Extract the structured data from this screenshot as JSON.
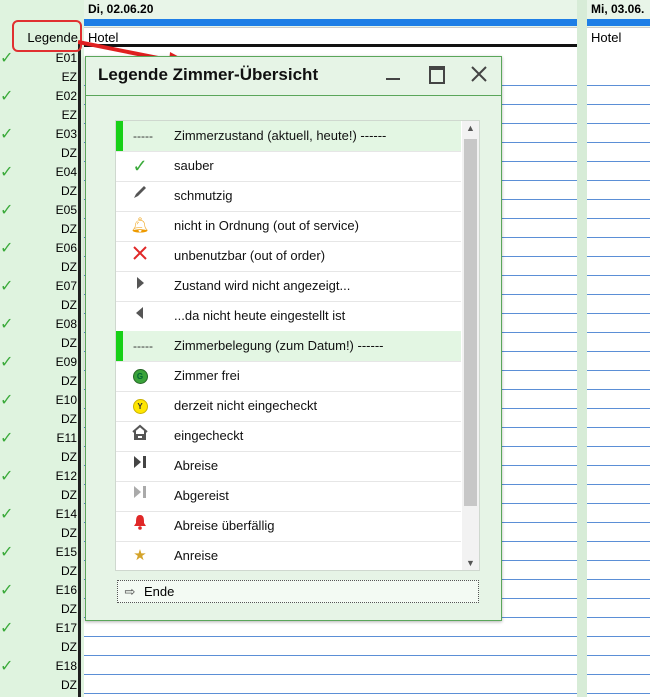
{
  "planner": {
    "legend_label": "Legende",
    "day1_header": "Di, 02.06.20",
    "day2_header": "Mi, 03.06.",
    "hotel_label": "Hotel",
    "rooms": [
      {
        "label": "E01",
        "check": true
      },
      {
        "label": "EZ",
        "check": false
      },
      {
        "label": "E02",
        "check": true
      },
      {
        "label": "EZ",
        "check": false
      },
      {
        "label": "E03",
        "check": true
      },
      {
        "label": "DZ",
        "check": false
      },
      {
        "label": "E04",
        "check": true
      },
      {
        "label": "DZ",
        "check": false
      },
      {
        "label": "E05",
        "check": true
      },
      {
        "label": "DZ",
        "check": false
      },
      {
        "label": "E06",
        "check": true
      },
      {
        "label": "DZ",
        "check": false
      },
      {
        "label": "E07",
        "check": true
      },
      {
        "label": "DZ",
        "check": false
      },
      {
        "label": "E08",
        "check": true
      },
      {
        "label": "DZ",
        "check": false
      },
      {
        "label": "E09",
        "check": true
      },
      {
        "label": "DZ",
        "check": false
      },
      {
        "label": "E10",
        "check": true
      },
      {
        "label": "DZ",
        "check": false
      },
      {
        "label": "E11",
        "check": true
      },
      {
        "label": "DZ",
        "check": false
      },
      {
        "label": "E12",
        "check": true
      },
      {
        "label": "DZ",
        "check": false
      },
      {
        "label": "E14",
        "check": true
      },
      {
        "label": "DZ",
        "check": false
      },
      {
        "label": "E15",
        "check": true
      },
      {
        "label": "DZ",
        "check": false
      },
      {
        "label": "E16",
        "check": true
      },
      {
        "label": "DZ",
        "check": false
      },
      {
        "label": "E17",
        "check": true
      },
      {
        "label": "DZ",
        "check": false
      },
      {
        "label": "E18",
        "check": true
      },
      {
        "label": "DZ",
        "check": false
      }
    ]
  },
  "dialog": {
    "title": "Legende Zimmer-Übersicht",
    "items": [
      {
        "icon": "dashes",
        "text": "Zimmerzustand (aktuell, heute!) ------",
        "header": true,
        "icon_text": "-----"
      },
      {
        "icon": "check-icon",
        "text": "sauber"
      },
      {
        "icon": "pencil-icon",
        "text": "schmutzig"
      },
      {
        "icon": "bell-orange-icon",
        "text": "nicht in Ordnung (out of service)"
      },
      {
        "icon": "cross-red-icon",
        "text": "unbenutzbar (out of order)"
      },
      {
        "icon": "triangle-right-icon",
        "text": "Zustand wird nicht angezeigt..."
      },
      {
        "icon": "triangle-left-icon",
        "text": "...da nicht heute eingestellt ist"
      },
      {
        "icon": "dashes",
        "text": "Zimmerbelegung (zum Datum!) ------",
        "header": true,
        "icon_text": "-----"
      },
      {
        "icon": "circle-g-icon",
        "text": "Zimmer frei",
        "icon_text": "G"
      },
      {
        "icon": "circle-y-icon",
        "text": "derzeit nicht eingecheckt",
        "icon_text": "Y"
      },
      {
        "icon": "house-icon",
        "text": "eingecheckt"
      },
      {
        "icon": "departure-icon",
        "text": "Abreise"
      },
      {
        "icon": "departed-icon",
        "text": "Abgereist"
      },
      {
        "icon": "bell-red-icon",
        "text": "Abreise überfällig"
      },
      {
        "icon": "star-icon",
        "text": "Anreise"
      }
    ],
    "ende_label": "Ende"
  }
}
